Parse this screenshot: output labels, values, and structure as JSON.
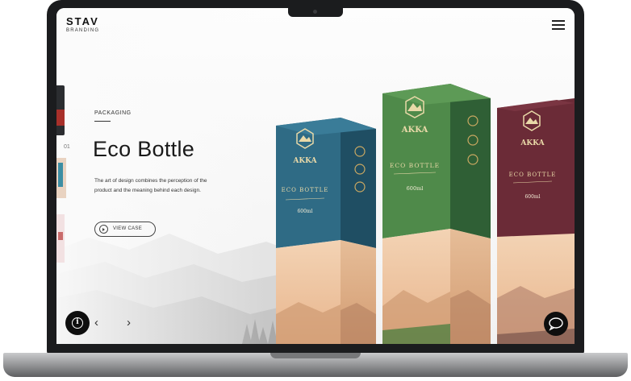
{
  "brand": {
    "name": "STAV",
    "tagline": "BRANDING"
  },
  "hero": {
    "category": "PACKAGING",
    "title": "Eco Bottle",
    "description": "The art of design combines the perception of the product and the meaning behind each design.",
    "cta_label": "VIEW CASE",
    "slide_number": "01"
  },
  "product": {
    "brand": "AKKA",
    "name": "ECO BOTTLE",
    "volume": "600ml",
    "variants": [
      {
        "color": "#2f6b85"
      },
      {
        "color": "#4f8a4a"
      },
      {
        "color": "#6b2b37"
      }
    ]
  },
  "controls": {
    "info_icon": "info-icon",
    "prev_icon": "chevron-left-icon",
    "next_icon": "chevron-right-icon",
    "chat_icon": "chat-bubble-icon",
    "menu_icon": "hamburger-menu-icon"
  }
}
